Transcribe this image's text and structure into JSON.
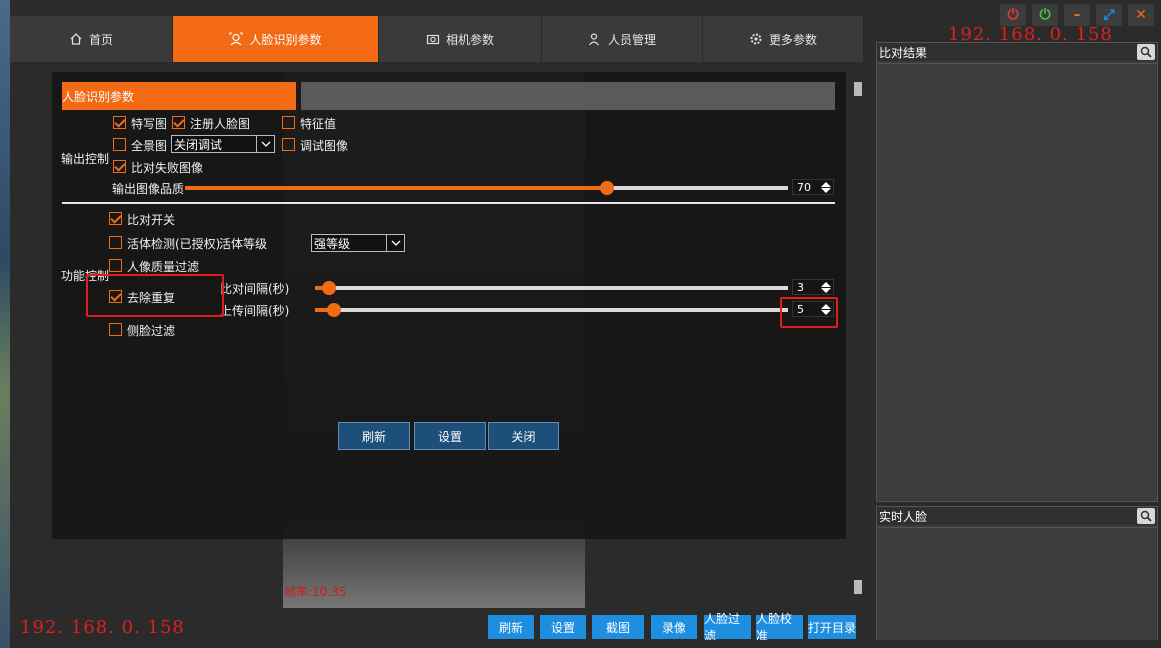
{
  "window": {
    "ip_top": "192. 168. 0. 158",
    "ip_bottom": "192. 168. 0. 158",
    "controls": [
      {
        "name": "power-icon",
        "glyph": "⏻",
        "color": "#e53935"
      },
      {
        "name": "status-icon",
        "glyph": "⏼",
        "color": "#43c243"
      },
      {
        "name": "minimize-icon",
        "glyph": "–",
        "color": "#f36a14"
      },
      {
        "name": "fullscreen-icon",
        "glyph": "⤢",
        "color": "#1e8ee0"
      },
      {
        "name": "close-icon",
        "glyph": "✕",
        "color": "#f36a14"
      }
    ]
  },
  "nav": {
    "tabs": [
      {
        "label": "首页",
        "icon": "home-icon",
        "active": false
      },
      {
        "label": "人脸识别参数",
        "icon": "face-icon",
        "active": true
      },
      {
        "label": "相机参数",
        "icon": "camera-icon",
        "active": false
      },
      {
        "label": "人员管理",
        "icon": "person-icon",
        "active": false
      },
      {
        "label": "更多参数",
        "icon": "gear-icon",
        "active": false
      }
    ]
  },
  "side": {
    "compare_title": "比对结果",
    "realtime_title": "实时人脸"
  },
  "video": {
    "status": "帧率:10.35"
  },
  "dialog": {
    "title": "人脸识别参数",
    "output_section": "输出控制",
    "function_section": "功能控制",
    "cb_closeup": "特写图",
    "cb_register": "注册人脸图",
    "cb_feature": "特征值",
    "cb_panorama": "全景图",
    "cb_debug_image": "调试图像",
    "cb_fail_image": "比对失败图像",
    "debug_select": "关闭调试",
    "quality_label": "输出图像品质",
    "quality_value": "70",
    "cb_compare_switch": "比对开关",
    "cb_liveness": "活体检测(已授权)",
    "liveness_level_label": "活体等级",
    "liveness_level": "强等级",
    "cb_quality_filter": "人像质量过滤",
    "cb_dedup": "去除重复",
    "cb_side_filter": "侧脸过滤",
    "compare_interval_label": "比对间隔(秒)",
    "compare_interval": "3",
    "upload_interval_label": "上传间隔(秒)",
    "upload_interval": "5",
    "btn_refresh": "刷新",
    "btn_set": "设置",
    "btn_close": "关闭",
    "checked": {
      "closeup": true,
      "register": true,
      "feature": false,
      "panorama": false,
      "debug_image": false,
      "fail_image": true,
      "compare_switch": true,
      "liveness": false,
      "quality_filter": false,
      "dedup": true,
      "side_filter": false
    },
    "sliders": {
      "quality_fraction": 0.7,
      "compare_fraction": 0.03,
      "upload_fraction": 0.04
    }
  },
  "toolbar": {
    "buttons": [
      "刷新",
      "设置",
      "截图",
      "录像",
      "人脸过滤",
      "人脸校准",
      "打开目录"
    ]
  }
}
